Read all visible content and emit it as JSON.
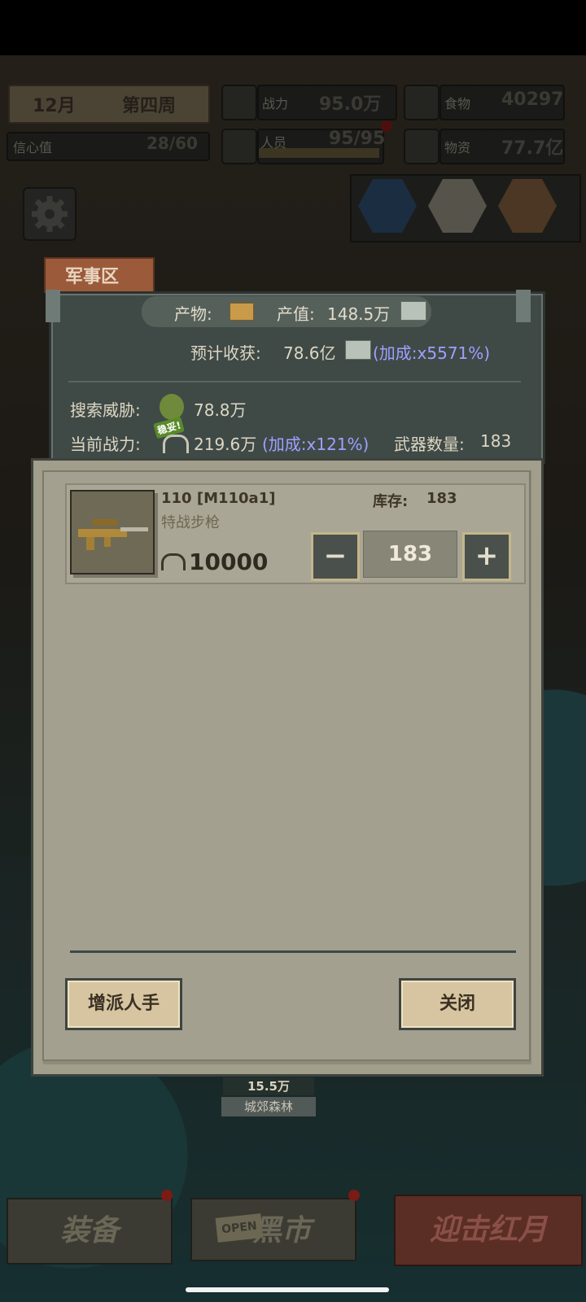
{
  "hud": {
    "month": "12月",
    "week": "第四周",
    "confidence_label": "信心值",
    "confidence_value": "28/60",
    "power_label": "战力",
    "power_value": "95.0万",
    "staff_label": "人员",
    "staff_value": "95/95",
    "food_label": "食物",
    "food_value": "40297",
    "supplies_label": "物资",
    "supplies_value": "77.7亿"
  },
  "area_tag": "军事区",
  "info": {
    "product_label": "产物:",
    "output_label": "产值:",
    "output_value": "148.5万",
    "expected_label": "预计收获:",
    "expected_value": "78.6亿",
    "expected_bonus": "(加成:x5571%)",
    "threat_label": "搜索威胁:",
    "threat_value": "78.8万",
    "current_power_label": "当前战力:",
    "power_badge": "稳妥!",
    "current_power_value": "219.6万",
    "current_power_bonus": "(加成:x121%)",
    "weapons_count_label": "武器数量:",
    "weapons_count_value": "183"
  },
  "item": {
    "name": "110 [M110a1]",
    "type": "特战步枪",
    "stock_label": "库存:",
    "stock_value": "183",
    "power": "10000",
    "quantity": "183",
    "minus": "−",
    "plus": "+"
  },
  "buttons": {
    "assign": "增派人手",
    "close": "关闭"
  },
  "map_label": {
    "value": "15.5万",
    "name": "城郊森林"
  },
  "bottom": {
    "equip": "装备",
    "open_sign": "OPEN",
    "market": "黑市",
    "attack": "迎击红月"
  },
  "colors": {
    "accent_purple": "#9fa0ff",
    "button_fill": "#d6c5a0",
    "dialog_bg": "#a3a090"
  }
}
